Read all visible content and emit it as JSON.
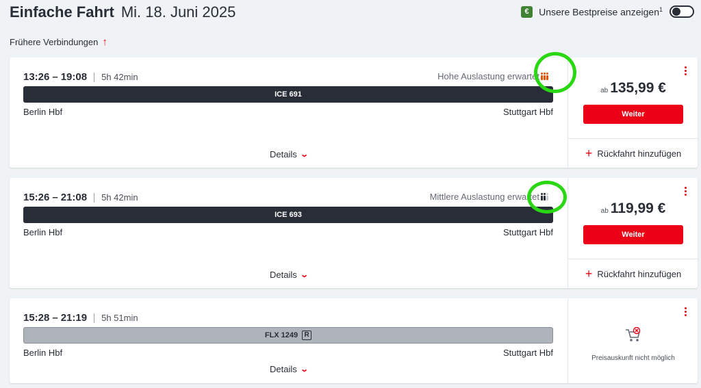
{
  "header": {
    "title": "Einfache Fahrt",
    "date": "Mi. 18. Juni 2025"
  },
  "bestprice": {
    "badge": "€",
    "label": "Unsere Bestpreise anzeigen",
    "sup": "1",
    "toggle_on": false
  },
  "earlier": {
    "label": "Frühere Verbindungen",
    "arrow": "↑"
  },
  "connections": [
    {
      "dep": "13:26",
      "arr": "19:08",
      "dash": "–",
      "duration": "5h 42min",
      "load_text": "Hohe Auslastung erwartet",
      "load_color": "#e35205",
      "train": "ICE 691",
      "from": "Berlin Hbf",
      "to": "Stuttgart Hbf",
      "details": "Details",
      "price_prefix": "ab",
      "price": "135,99 €",
      "button": "Weiter",
      "return_label": "Rückfahrt hinzufügen"
    },
    {
      "dep": "15:26",
      "arr": "21:08",
      "dash": "–",
      "duration": "5h 42min",
      "load_text": "Mittlere Auslastung erwartet",
      "load_color": "#282d37",
      "train": "ICE 693",
      "from": "Berlin Hbf",
      "to": "Stuttgart Hbf",
      "details": "Details",
      "price_prefix": "ab",
      "price": "119,99 €",
      "button": "Weiter",
      "return_label": "Rückfahrt hinzufügen"
    },
    {
      "dep": "15:28",
      "arr": "21:19",
      "dash": "–",
      "duration": "5h 51min",
      "train": "FLX 1249",
      "train_badge": "R",
      "from": "Berlin Hbf",
      "to": "Stuttgart Hbf",
      "details": "Details",
      "no_price": "Preisauskunft nicht möglich"
    }
  ],
  "colors": {
    "accent": "#ec0016",
    "annotation": "#2ad713"
  }
}
